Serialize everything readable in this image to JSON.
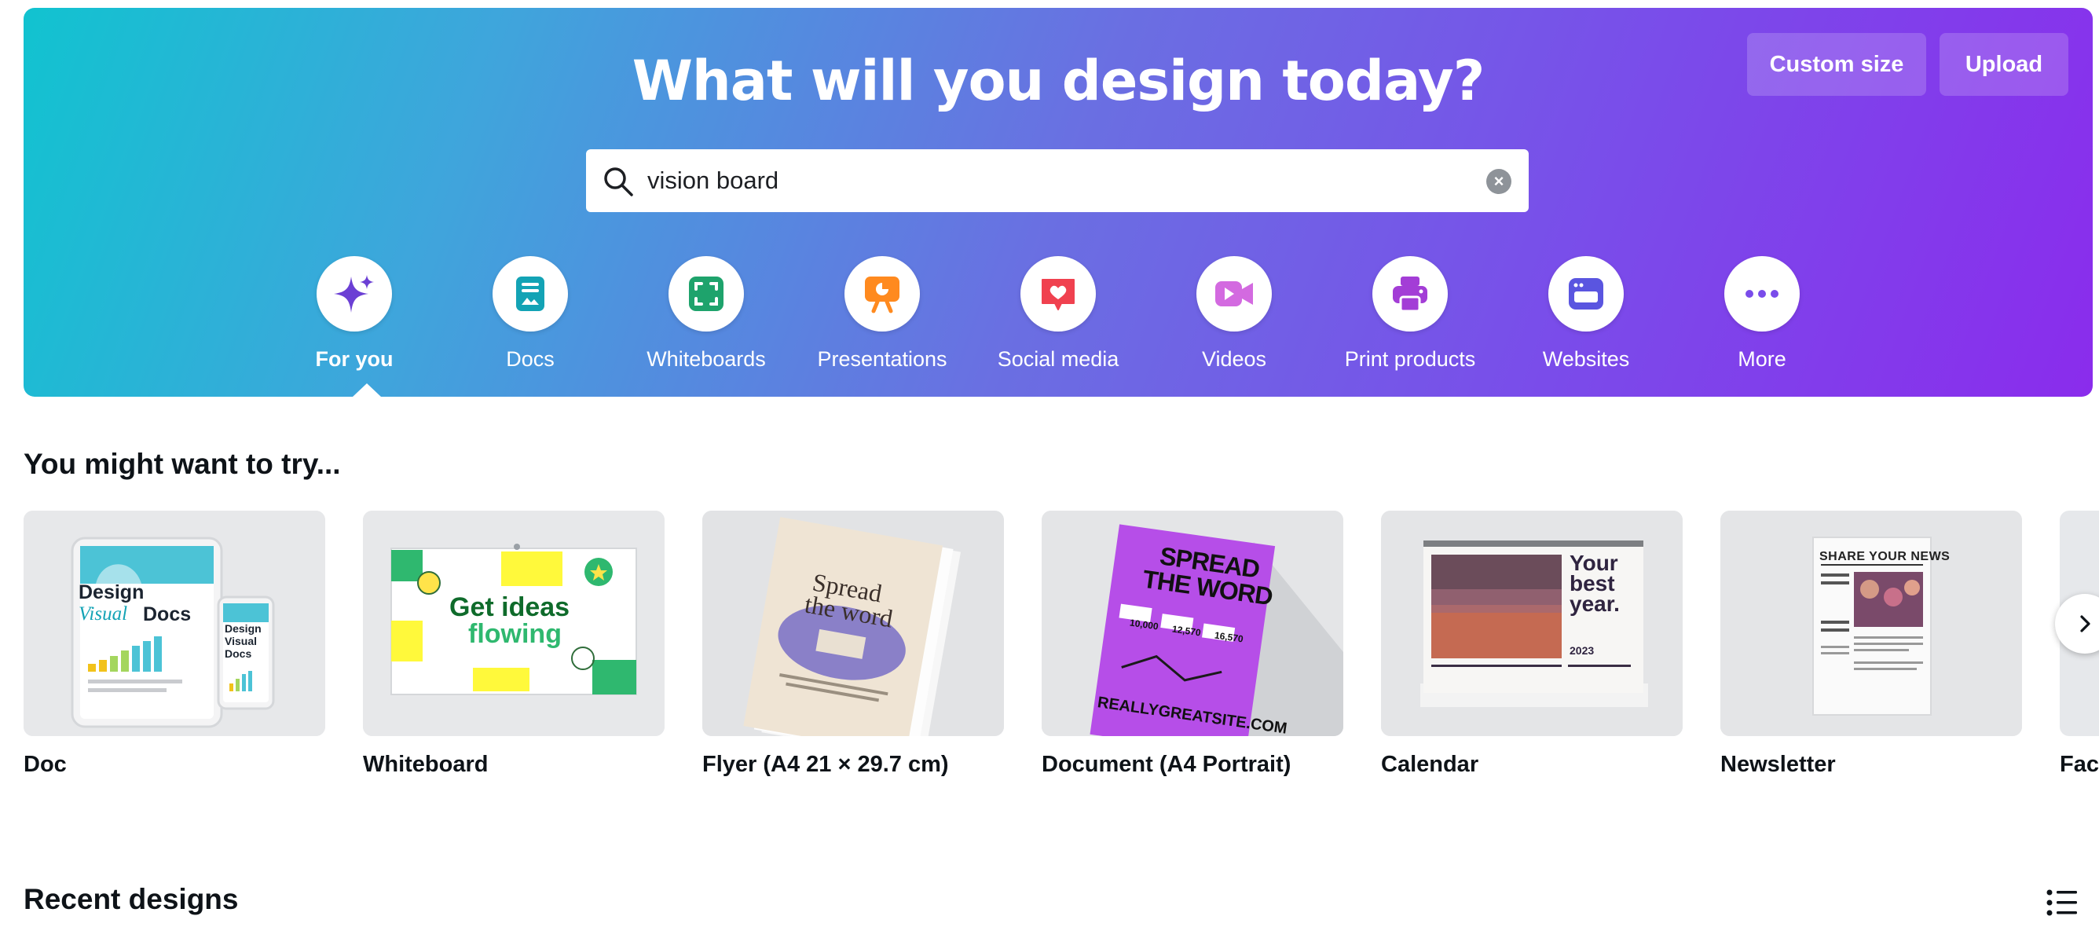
{
  "header": {
    "title": "What will you design today?",
    "custom_size_label": "Custom size",
    "upload_label": "Upload"
  },
  "search": {
    "value": "vision board"
  },
  "categories": [
    {
      "label": "For you",
      "icon": "sparkle-icon",
      "color": "#6b3fd4",
      "active": true
    },
    {
      "label": "Docs",
      "icon": "doc-icon",
      "color": "#13a3b5"
    },
    {
      "label": "Whiteboards",
      "icon": "whiteboard-icon",
      "color": "#1ea36c"
    },
    {
      "label": "Presentations",
      "icon": "presentation-icon",
      "color": "#ff8a1f"
    },
    {
      "label": "Social media",
      "icon": "heart-icon",
      "color": "#f0414f"
    },
    {
      "label": "Videos",
      "icon": "video-icon",
      "color": "#d36ae0"
    },
    {
      "label": "Print products",
      "icon": "printer-icon",
      "color": "#a33dd6"
    },
    {
      "label": "Websites",
      "icon": "website-icon",
      "color": "#5a55e0"
    },
    {
      "label": "More",
      "icon": "more-icon",
      "color": "#7a4cea"
    }
  ],
  "try_section": {
    "title": "You might want to try...",
    "items": [
      {
        "name": "Doc",
        "thumb": {
          "design": "Design",
          "visual": "Visual",
          "docs": "Docs"
        }
      },
      {
        "name": "Whiteboard",
        "thumb": {
          "line1": "Get ideas",
          "line2": "flowing"
        }
      },
      {
        "name": "Flyer (A4 21 × 29.7 cm)",
        "thumb": {
          "line1": "Spread",
          "line2": "the word"
        }
      },
      {
        "name": "Document (A4 Portrait)",
        "thumb": {
          "line1": "SPREAD",
          "line2": "THE WORD",
          "n1": "10,000",
          "n2": "12,570",
          "n3": "16,570",
          "url": "REALLYGREATSITE.COM"
        }
      },
      {
        "name": "Calendar",
        "thumb": {
          "line1": "Your",
          "line2": "best",
          "line3": "year.",
          "year": "2023"
        }
      },
      {
        "name": "Newsletter",
        "thumb": {
          "headline": "SHARE YOUR NEWS"
        }
      },
      {
        "name": "Fac"
      }
    ]
  },
  "recent_section": {
    "title": "Recent designs"
  }
}
